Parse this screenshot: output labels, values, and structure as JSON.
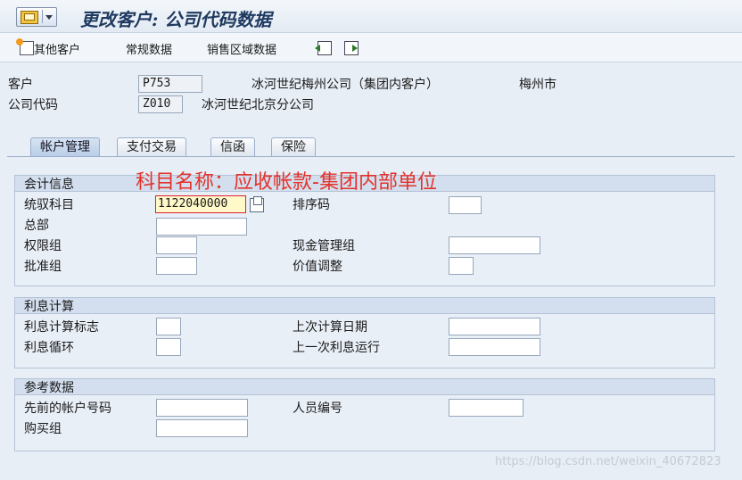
{
  "title": "更改客户: 公司代码数据",
  "toolbar": {
    "items": [
      "其他客户",
      "常规数据",
      "销售区域数据"
    ]
  },
  "header": {
    "customer_label": "客户",
    "customer_value": "P753",
    "customer_name": "冰河世纪梅州公司（集团内客户）",
    "customer_city": "梅州市",
    "company_code_label": "公司代码",
    "company_code_value": "Z010",
    "company_code_name": "冰河世纪北京分公司"
  },
  "tabs": [
    "帐户管理",
    "支付交易",
    "信函",
    "保险"
  ],
  "annotation": "科目名称：应收帐款-集团内部单位",
  "groups": {
    "accounting": {
      "title": "会计信息",
      "recon_account_label": "统驭科目",
      "recon_account_value": "1122040000",
      "sort_key_label": "排序码",
      "head_office_label": "总部",
      "auth_group_label": "权限组",
      "cash_mgmt_group_label": "现金管理组",
      "release_group_label": "批准组",
      "value_adjust_label": "价值调整"
    },
    "interest": {
      "title": "利息计算",
      "indicator_label": "利息计算标志",
      "last_calc_date_label": "上次计算日期",
      "cycle_label": "利息循环",
      "last_run_label": "上一次利息运行"
    },
    "reference": {
      "title": "参考数据",
      "prev_account_label": "先前的帐户号码",
      "personnel_no_label": "人员编号",
      "buying_group_label": "购买组"
    }
  },
  "watermark": "https://blog.csdn.net/weixin_40672823"
}
